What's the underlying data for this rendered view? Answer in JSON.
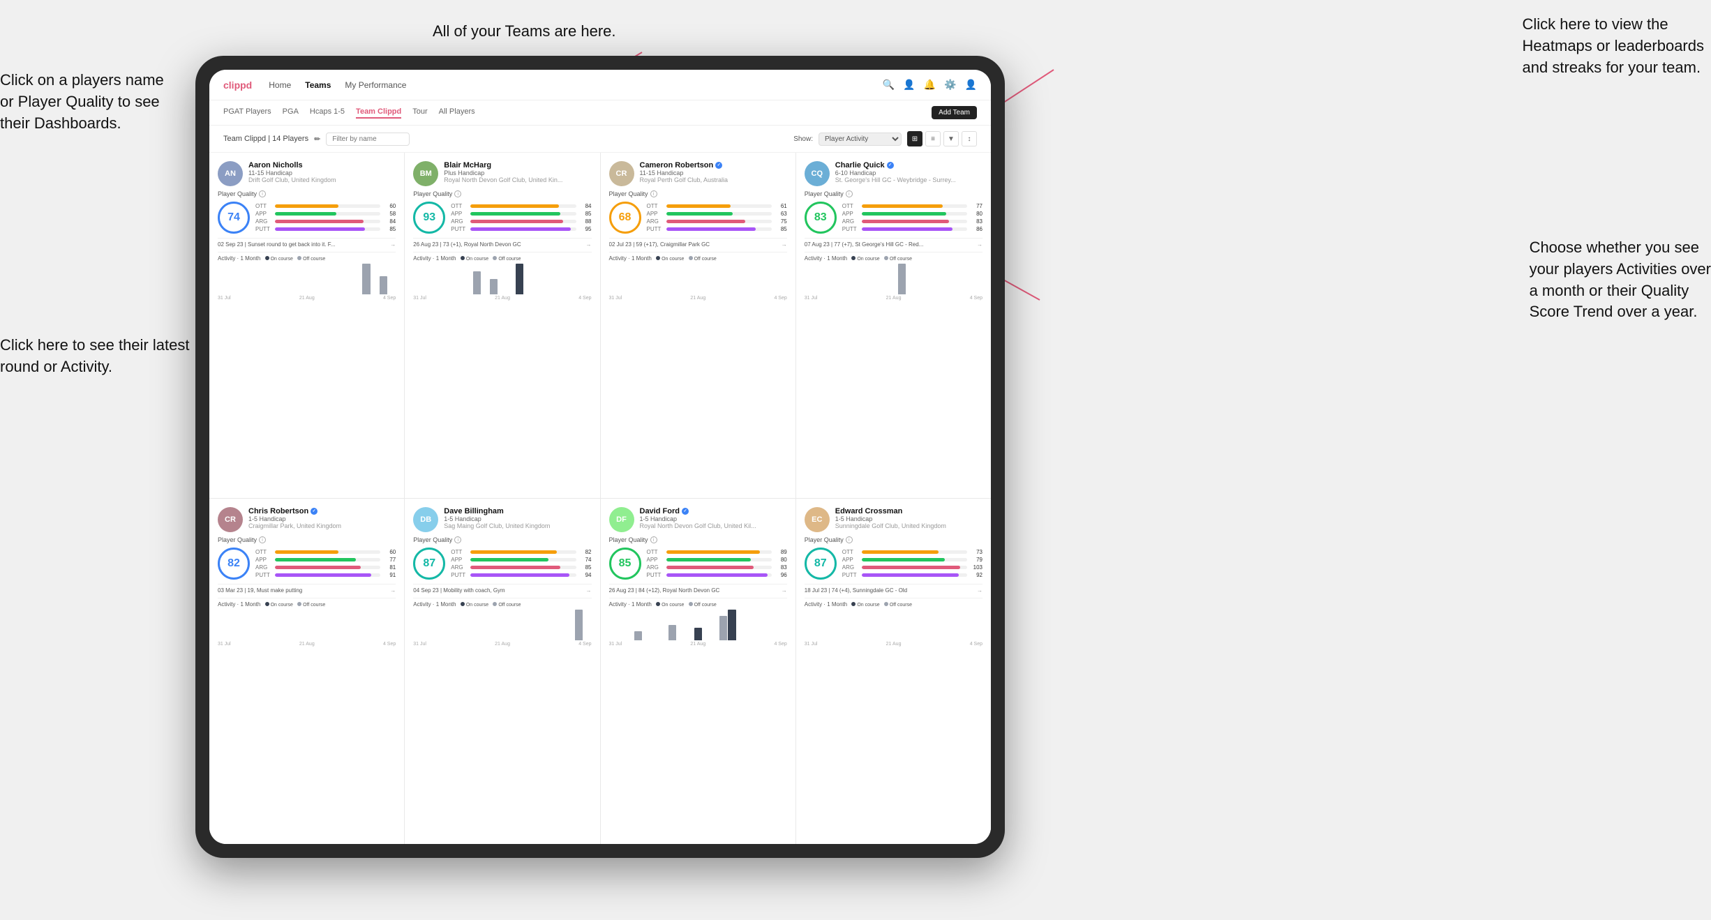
{
  "annotations": {
    "teams_note": "All of your Teams are here.",
    "heatmaps_note": "Click here to view the\nHeatmaps or leaderboards\nand streaks for your team.",
    "players_note": "Click on a players name\nor Player Quality to see\ntheir Dashboards.",
    "round_note": "Click here to see their latest\nround or Activity.",
    "activities_note": "Choose whether you see\nyour players Activities over\na month or their Quality\nScore Trend over a year."
  },
  "navbar": {
    "brand": "clippd",
    "links": [
      "Home",
      "Teams",
      "My Performance"
    ],
    "active_link": "Teams"
  },
  "subnav": {
    "links": [
      "PGAT Players",
      "PGA",
      "Hcaps 1-5",
      "Team Clippd",
      "Tour",
      "All Players"
    ],
    "active_link": "Team Clippd",
    "add_team_label": "Add Team"
  },
  "filterbar": {
    "team_label": "Team Clippd | 14 Players",
    "filter_placeholder": "Filter by name",
    "show_label": "Show:",
    "show_value": "Player Activity",
    "edit_icon": "✏"
  },
  "players": [
    {
      "name": "Aaron Nicholls",
      "handicap": "11-15 Handicap",
      "club": "Drift Golf Club, United Kingdom",
      "verified": false,
      "score": 74,
      "score_color": "blue",
      "stats": [
        {
          "label": "OTT",
          "color": "#f59e0b",
          "value": 60,
          "max": 100
        },
        {
          "label": "APP",
          "color": "#22c55e",
          "value": 58,
          "max": 100
        },
        {
          "label": "ARG",
          "color": "#e05a7a",
          "value": 84,
          "max": 100
        },
        {
          "label": "PUTT",
          "color": "#a855f7",
          "value": 85,
          "max": 100
        }
      ],
      "latest_round": "02 Sep 23 | Sunset round to get back into it. F...",
      "activity_header": "Activity · 1 Month",
      "bars": [
        0,
        0,
        0,
        0,
        0,
        0,
        0,
        0,
        0,
        0,
        0,
        0,
        0,
        0,
        0,
        0,
        0,
        5,
        0,
        3,
        0
      ],
      "chart_labels": [
        "31 Jul",
        "21 Aug",
        "4 Sep"
      ]
    },
    {
      "name": "Blair McHarg",
      "handicap": "Plus Handicap",
      "club": "Royal North Devon Golf Club, United Kin...",
      "verified": false,
      "score": 93,
      "score_color": "teal",
      "stats": [
        {
          "label": "OTT",
          "color": "#f59e0b",
          "value": 84,
          "max": 100
        },
        {
          "label": "APP",
          "color": "#22c55e",
          "value": 85,
          "max": 100
        },
        {
          "label": "ARG",
          "color": "#e05a7a",
          "value": 88,
          "max": 100
        },
        {
          "label": "PUTT",
          "color": "#a855f7",
          "value": 95,
          "max": 100
        }
      ],
      "latest_round": "26 Aug 23 | 73 (+1), Royal North Devon GC",
      "activity_header": "Activity · 1 Month",
      "bars": [
        0,
        0,
        0,
        0,
        0,
        0,
        0,
        6,
        0,
        4,
        0,
        0,
        8,
        0,
        0,
        0,
        0,
        0,
        0,
        0,
        0
      ],
      "chart_labels": [
        "31 Jul",
        "21 Aug",
        "4 Sep"
      ]
    },
    {
      "name": "Cameron Robertson",
      "handicap": "11-15 Handicap",
      "club": "Royal Perth Golf Club, Australia",
      "verified": true,
      "score": 68,
      "score_color": "orange",
      "stats": [
        {
          "label": "OTT",
          "color": "#f59e0b",
          "value": 61,
          "max": 100
        },
        {
          "label": "APP",
          "color": "#22c55e",
          "value": 63,
          "max": 100
        },
        {
          "label": "ARG",
          "color": "#e05a7a",
          "value": 75,
          "max": 100
        },
        {
          "label": "PUTT",
          "color": "#a855f7",
          "value": 85,
          "max": 100
        }
      ],
      "latest_round": "02 Jul 23 | 59 (+17), Craigmillar Park GC",
      "activity_header": "Activity · 1 Month",
      "bars": [
        0,
        0,
        0,
        0,
        0,
        0,
        0,
        0,
        0,
        0,
        0,
        0,
        0,
        0,
        0,
        0,
        0,
        0,
        0,
        0,
        0
      ],
      "chart_labels": [
        "31 Jul",
        "21 Aug",
        "4 Sep"
      ]
    },
    {
      "name": "Charlie Quick",
      "handicap": "6-10 Handicap",
      "club": "St. George's Hill GC - Weybridge - Surrey...",
      "verified": true,
      "score": 83,
      "score_color": "green",
      "stats": [
        {
          "label": "OTT",
          "color": "#f59e0b",
          "value": 77,
          "max": 100
        },
        {
          "label": "APP",
          "color": "#22c55e",
          "value": 80,
          "max": 100
        },
        {
          "label": "ARG",
          "color": "#e05a7a",
          "value": 83,
          "max": 100
        },
        {
          "label": "PUTT",
          "color": "#a855f7",
          "value": 86,
          "max": 100
        }
      ],
      "latest_round": "07 Aug 23 | 77 (+7), St George's Hill GC - Red...",
      "activity_header": "Activity · 1 Month",
      "bars": [
        0,
        0,
        0,
        0,
        0,
        0,
        0,
        0,
        0,
        0,
        0,
        4,
        0,
        0,
        0,
        0,
        0,
        0,
        0,
        0,
        0
      ],
      "chart_labels": [
        "31 Jul",
        "21 Aug",
        "4 Sep"
      ]
    },
    {
      "name": "Chris Robertson",
      "handicap": "1-5 Handicap",
      "club": "Craigmillar Park, United Kingdom",
      "verified": true,
      "score": 82,
      "score_color": "blue",
      "stats": [
        {
          "label": "OTT",
          "color": "#f59e0b",
          "value": 60,
          "max": 100
        },
        {
          "label": "APP",
          "color": "#22c55e",
          "value": 77,
          "max": 100
        },
        {
          "label": "ARG",
          "color": "#e05a7a",
          "value": 81,
          "max": 100
        },
        {
          "label": "PUTT",
          "color": "#a855f7",
          "value": 91,
          "max": 100
        }
      ],
      "latest_round": "03 Mar 23 | 19, Must make putting",
      "activity_header": "Activity · 1 Month",
      "bars": [
        0,
        0,
        0,
        0,
        0,
        0,
        0,
        0,
        0,
        0,
        0,
        0,
        0,
        0,
        0,
        0,
        0,
        0,
        0,
        0,
        0
      ],
      "chart_labels": [
        "31 Jul",
        "21 Aug",
        "4 Sep"
      ]
    },
    {
      "name": "Dave Billingham",
      "handicap": "1-5 Handicap",
      "club": "Sag Maing Golf Club, United Kingdom",
      "verified": false,
      "score": 87,
      "score_color": "teal",
      "stats": [
        {
          "label": "OTT",
          "color": "#f59e0b",
          "value": 82,
          "max": 100
        },
        {
          "label": "APP",
          "color": "#22c55e",
          "value": 74,
          "max": 100
        },
        {
          "label": "ARG",
          "color": "#e05a7a",
          "value": 85,
          "max": 100
        },
        {
          "label": "PUTT",
          "color": "#a855f7",
          "value": 94,
          "max": 100
        }
      ],
      "latest_round": "04 Sep 23 | Mobility with coach, Gym",
      "activity_header": "Activity · 1 Month",
      "bars": [
        0,
        0,
        0,
        0,
        0,
        0,
        0,
        0,
        0,
        0,
        0,
        0,
        0,
        0,
        0,
        0,
        0,
        0,
        0,
        4,
        0
      ],
      "chart_labels": [
        "31 Jul",
        "21 Aug",
        "4 Sep"
      ]
    },
    {
      "name": "David Ford",
      "handicap": "1-5 Handicap",
      "club": "Royal North Devon Golf Club, United Kil...",
      "verified": true,
      "score": 85,
      "score_color": "green",
      "stats": [
        {
          "label": "OTT",
          "color": "#f59e0b",
          "value": 89,
          "max": 100
        },
        {
          "label": "APP",
          "color": "#22c55e",
          "value": 80,
          "max": 100
        },
        {
          "label": "ARG",
          "color": "#e05a7a",
          "value": 83,
          "max": 100
        },
        {
          "label": "PUTT",
          "color": "#a855f7",
          "value": 96,
          "max": 100
        }
      ],
      "latest_round": "26 Aug 23 | 84 (+12), Royal North Devon GC",
      "activity_header": "Activity · 1 Month",
      "bars": [
        0,
        0,
        0,
        3,
        0,
        0,
        0,
        5,
        0,
        0,
        4,
        0,
        0,
        8,
        10,
        0,
        0,
        0,
        0,
        0,
        0
      ],
      "chart_labels": [
        "31 Jul",
        "21 Aug",
        "4 Sep"
      ]
    },
    {
      "name": "Edward Crossman",
      "handicap": "1-5 Handicap",
      "club": "Sunningdale Golf Club, United Kingdom",
      "verified": false,
      "score": 87,
      "score_color": "teal",
      "stats": [
        {
          "label": "OTT",
          "color": "#f59e0b",
          "value": 73,
          "max": 100
        },
        {
          "label": "APP",
          "color": "#22c55e",
          "value": 79,
          "max": 100
        },
        {
          "label": "ARG",
          "color": "#e05a7a",
          "value": 103,
          "max": 110
        },
        {
          "label": "PUTT",
          "color": "#a855f7",
          "value": 92,
          "max": 100
        }
      ],
      "latest_round": "18 Jul 23 | 74 (+4), Sunningdale GC - Old",
      "activity_header": "Activity · 1 Month",
      "bars": [
        0,
        0,
        0,
        0,
        0,
        0,
        0,
        0,
        0,
        0,
        0,
        0,
        0,
        0,
        0,
        0,
        0,
        0,
        0,
        0,
        0
      ],
      "chart_labels": [
        "31 Jul",
        "21 Aug",
        "4 Sep"
      ]
    }
  ],
  "ui": {
    "on_course_color": "#374151",
    "off_course_color": "#9ca3af",
    "grid_line_color": "#f3f4f6"
  }
}
